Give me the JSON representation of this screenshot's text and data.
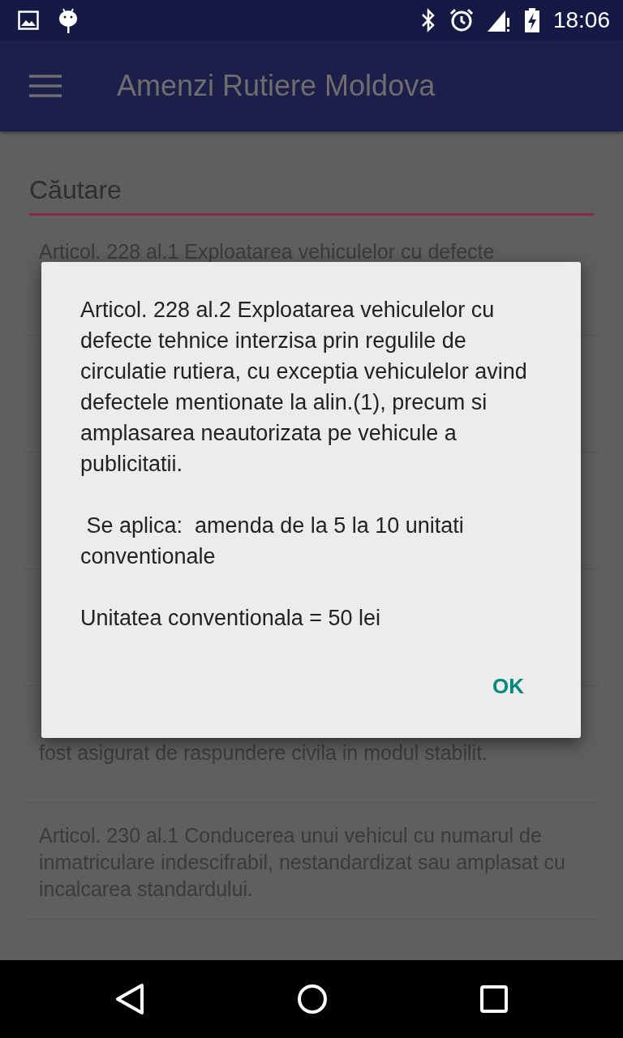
{
  "status_bar": {
    "time": "18:06"
  },
  "app_bar": {
    "title": "Amenzi Rutiere Moldova"
  },
  "search": {
    "placeholder": "Căutare"
  },
  "list_items": [
    {
      "text": "Articol. 228 al.1 Exploatarea vehiculelor cu defecte",
      "kind": "top"
    },
    {
      "kind": "hidden"
    },
    {
      "kind": "hidden"
    },
    {
      "kind": "hidden"
    },
    {
      "text": "fost asigurat de raspundere civila in modul stabilit.",
      "kind": "tail"
    },
    {
      "text": "Articol. 230 al.1 Conducerea unui vehicul cu numarul de inmatriculare indescifrabil, nestandardizat sau amplasat cu incalcarea standardului.",
      "kind": "full"
    }
  ],
  "dialog": {
    "paragraphs": [
      "Articol. 228 al.2 Exploatarea vehiculelor cu defecte tehnice interzisa prin regulile de circulatie rutiera, cu exceptia vehiculelor avind defectele mentionate la alin.(1), precum si amplasarea neautorizata pe vehicule a publicitatii.",
      " Se aplica:  amenda de la 5 la 10 unitati conventionale",
      "Unitatea conventionala = 50 lei"
    ],
    "button": "OK"
  }
}
